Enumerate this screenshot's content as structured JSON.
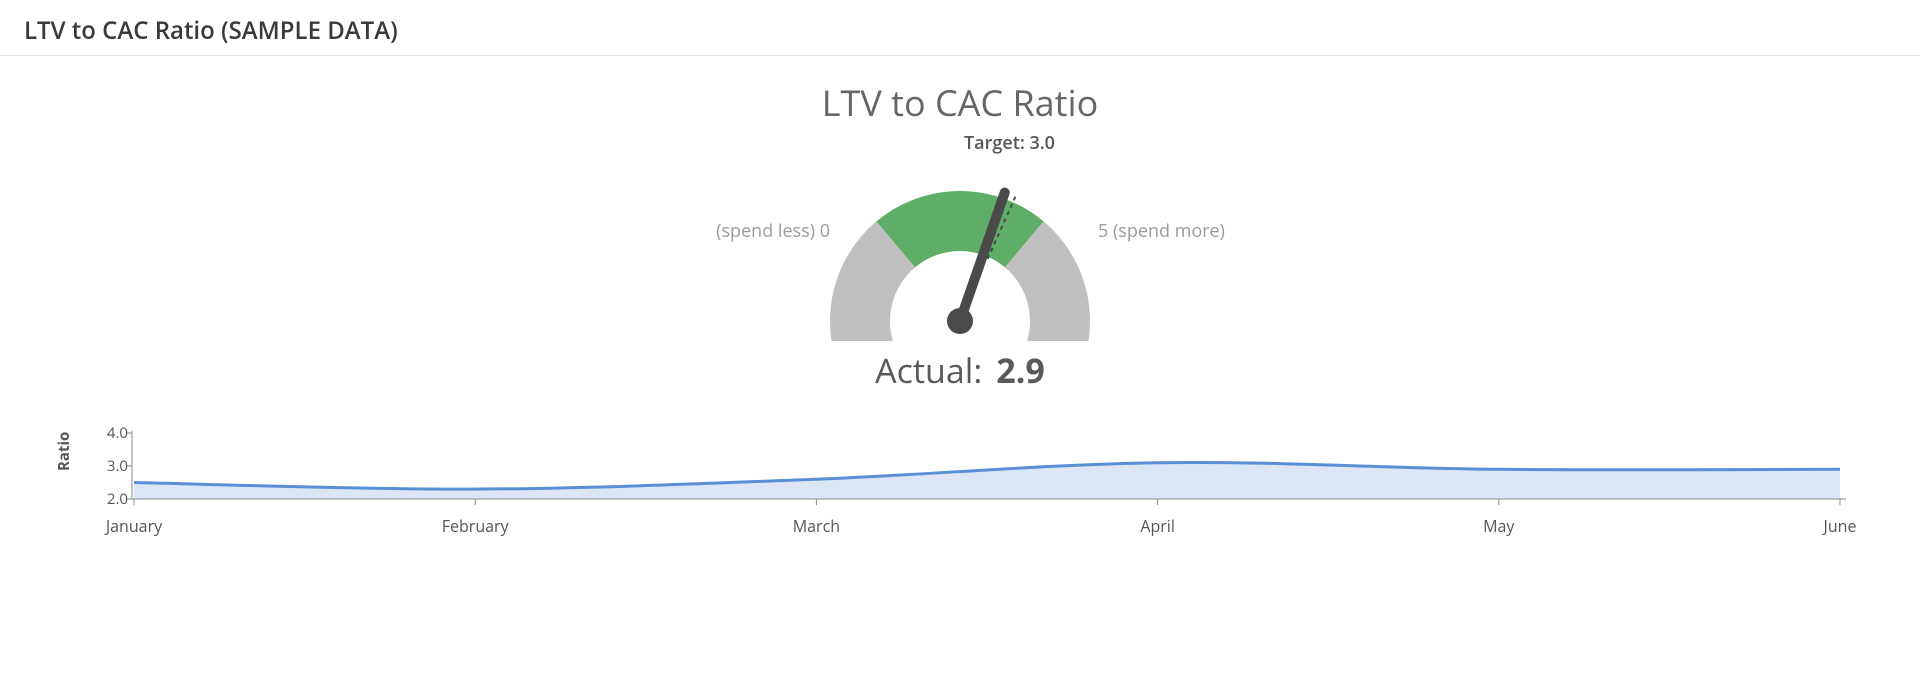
{
  "header": {
    "title": "LTV to CAC Ratio (SAMPLE DATA)"
  },
  "gauge": {
    "title": "LTV to CAC Ratio",
    "target_label": "Target: 3.0",
    "left_label": "(spend less) 0",
    "right_label": "5 (spend more)",
    "actual_label": "Actual:",
    "actual_value": "2.9",
    "min": 0,
    "max": 5,
    "green_from": 1.667,
    "green_to": 3.333,
    "target": 3.0,
    "value": 2.9
  },
  "trend": {
    "y_title": "Ratio",
    "y_ticks": [
      "4.0",
      "3.0",
      "2.0"
    ],
    "x_ticks": [
      "January",
      "February",
      "March",
      "April",
      "May",
      "June"
    ]
  },
  "chart_data": [
    {
      "type": "gauge",
      "title": "LTV to CAC Ratio",
      "range": [
        0,
        5
      ],
      "bands": [
        {
          "from": 0,
          "to": 1.667,
          "color": "#bfbfbf",
          "label": "spend less"
        },
        {
          "from": 1.667,
          "to": 3.333,
          "color": "#5fae67"
        },
        {
          "from": 3.333,
          "to": 5,
          "color": "#bfbfbf",
          "label": "spend more"
        }
      ],
      "target": 3.0,
      "value": 2.9,
      "value_label": "Actual: 2.9"
    },
    {
      "type": "area",
      "title": "",
      "xlabel": "",
      "ylabel": "Ratio",
      "ylim": [
        2.0,
        4.0
      ],
      "categories": [
        "January",
        "February",
        "March",
        "April",
        "May",
        "June"
      ],
      "series": [
        {
          "name": "Ratio",
          "values": [
            2.5,
            2.3,
            2.6,
            3.1,
            2.9,
            2.9
          ]
        }
      ]
    }
  ],
  "colors": {
    "gauge_grey": "#bfbfbf",
    "gauge_green": "#5fae67",
    "needle": "#4a4a4a",
    "line_stroke": "#5a8fd6",
    "line_fill": "#dbe7f6",
    "axis": "#888888"
  }
}
